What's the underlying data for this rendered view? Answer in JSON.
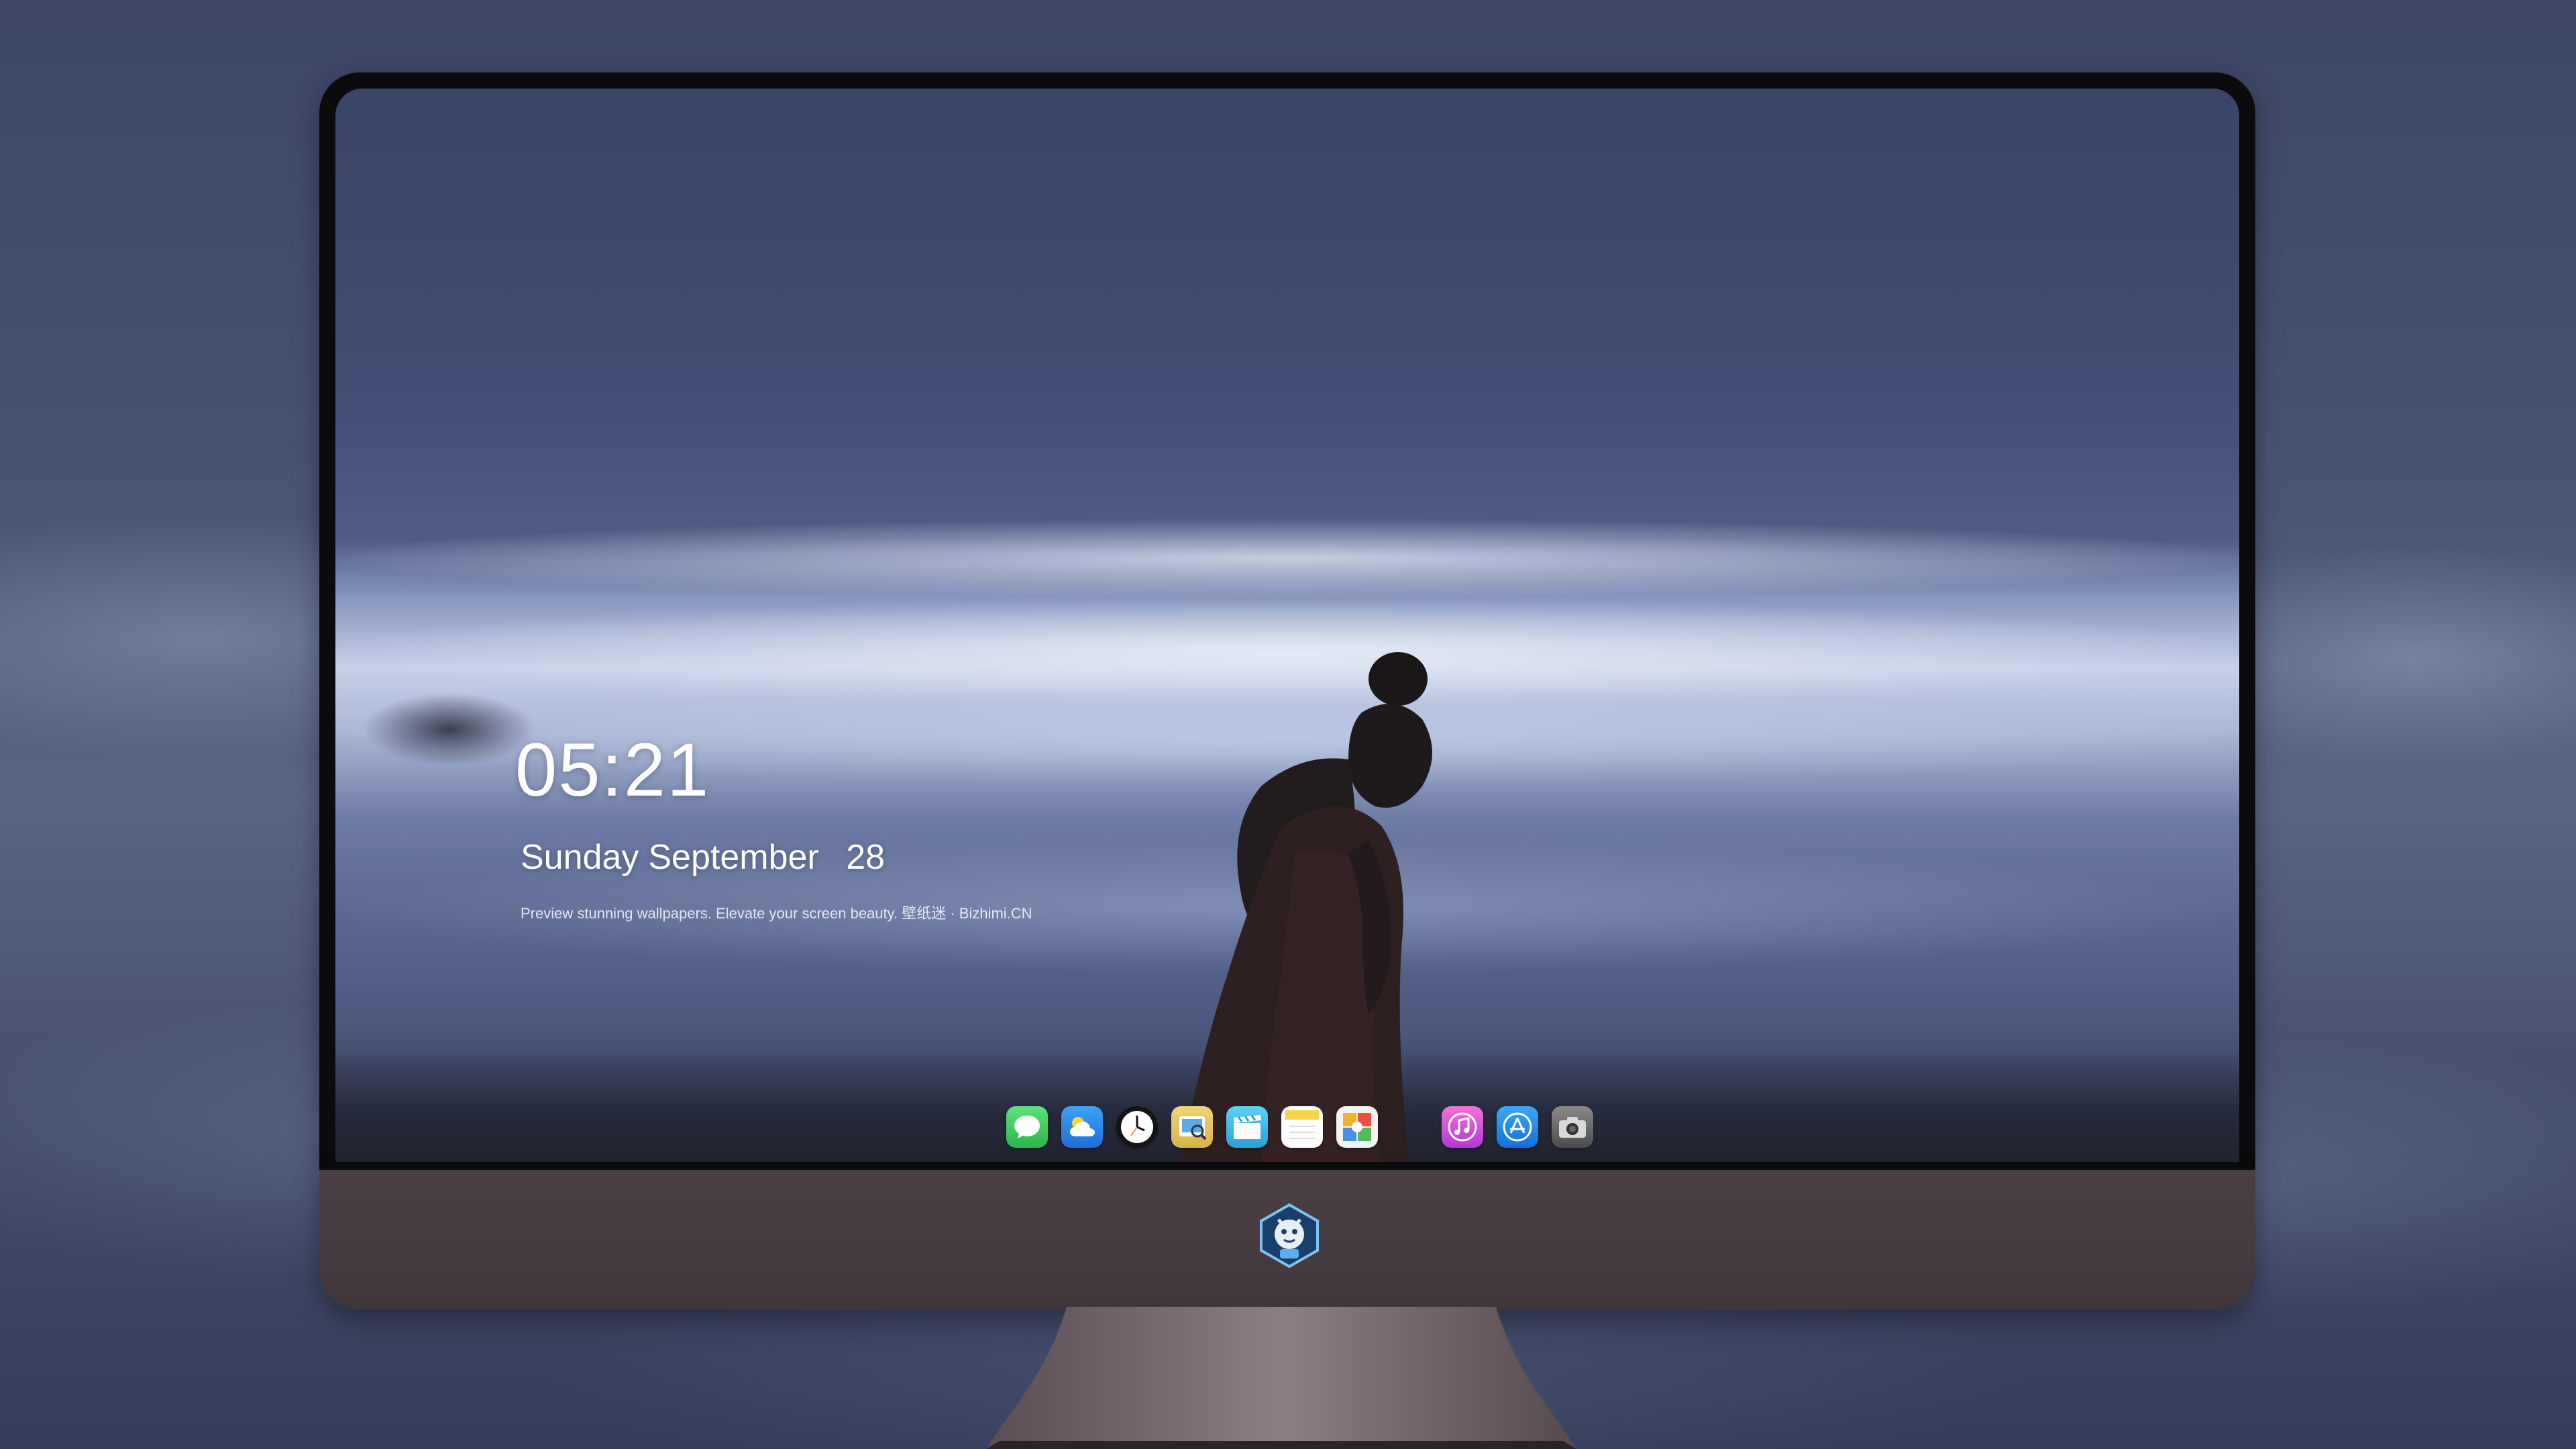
{
  "lock_screen": {
    "time": "05:21",
    "day": "Sunday",
    "month": "September",
    "date": "28",
    "tagline": "Preview stunning wallpapers. Elevate your screen beauty. 壁纸迷 · Bizhimi.CN"
  },
  "dock": {
    "apps": [
      {
        "name": "messages-icon",
        "color": "#34c759"
      },
      {
        "name": "weather-icon",
        "color": "#2f8ef0"
      },
      {
        "name": "clock-icon",
        "color": "#111111"
      },
      {
        "name": "preview-icon",
        "color": "#e8c84a"
      },
      {
        "name": "clips-icon",
        "color": "#3ab8e8"
      },
      {
        "name": "notes-icon",
        "color": "#f7d54a"
      },
      {
        "name": "photos-collage-icon",
        "color": "#f0f0f0"
      },
      {
        "name": "music-icon",
        "color": "#d94fd8"
      },
      {
        "name": "app-store-icon",
        "color": "#1f8ef1"
      },
      {
        "name": "camera-icon",
        "color": "#6b6b6b"
      }
    ]
  }
}
